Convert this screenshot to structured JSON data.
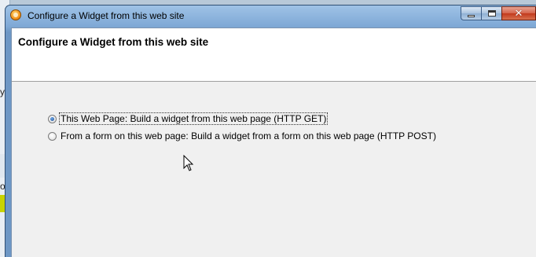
{
  "background_app": {
    "fragments": [
      "y",
      "o"
    ]
  },
  "window": {
    "title": "Configure a Widget from this web site",
    "icon": "widget-app-icon",
    "caption_buttons": {
      "minimize": "minimize-icon",
      "maximize": "maximize-icon",
      "close": "close-icon"
    }
  },
  "header": {
    "title": "Configure a Widget from this web site"
  },
  "options": [
    {
      "label": "This Web Page: Build a widget from this web page (HTTP GET)",
      "checked": true
    },
    {
      "label": "From a form on this web page: Build a widget from a form on this web page (HTTP POST)",
      "checked": false
    }
  ],
  "colors": {
    "title_bar": "#7fa9d6",
    "close_button": "#c2391c",
    "client_background": "#f0f0f0",
    "header_background": "#ffffff"
  }
}
